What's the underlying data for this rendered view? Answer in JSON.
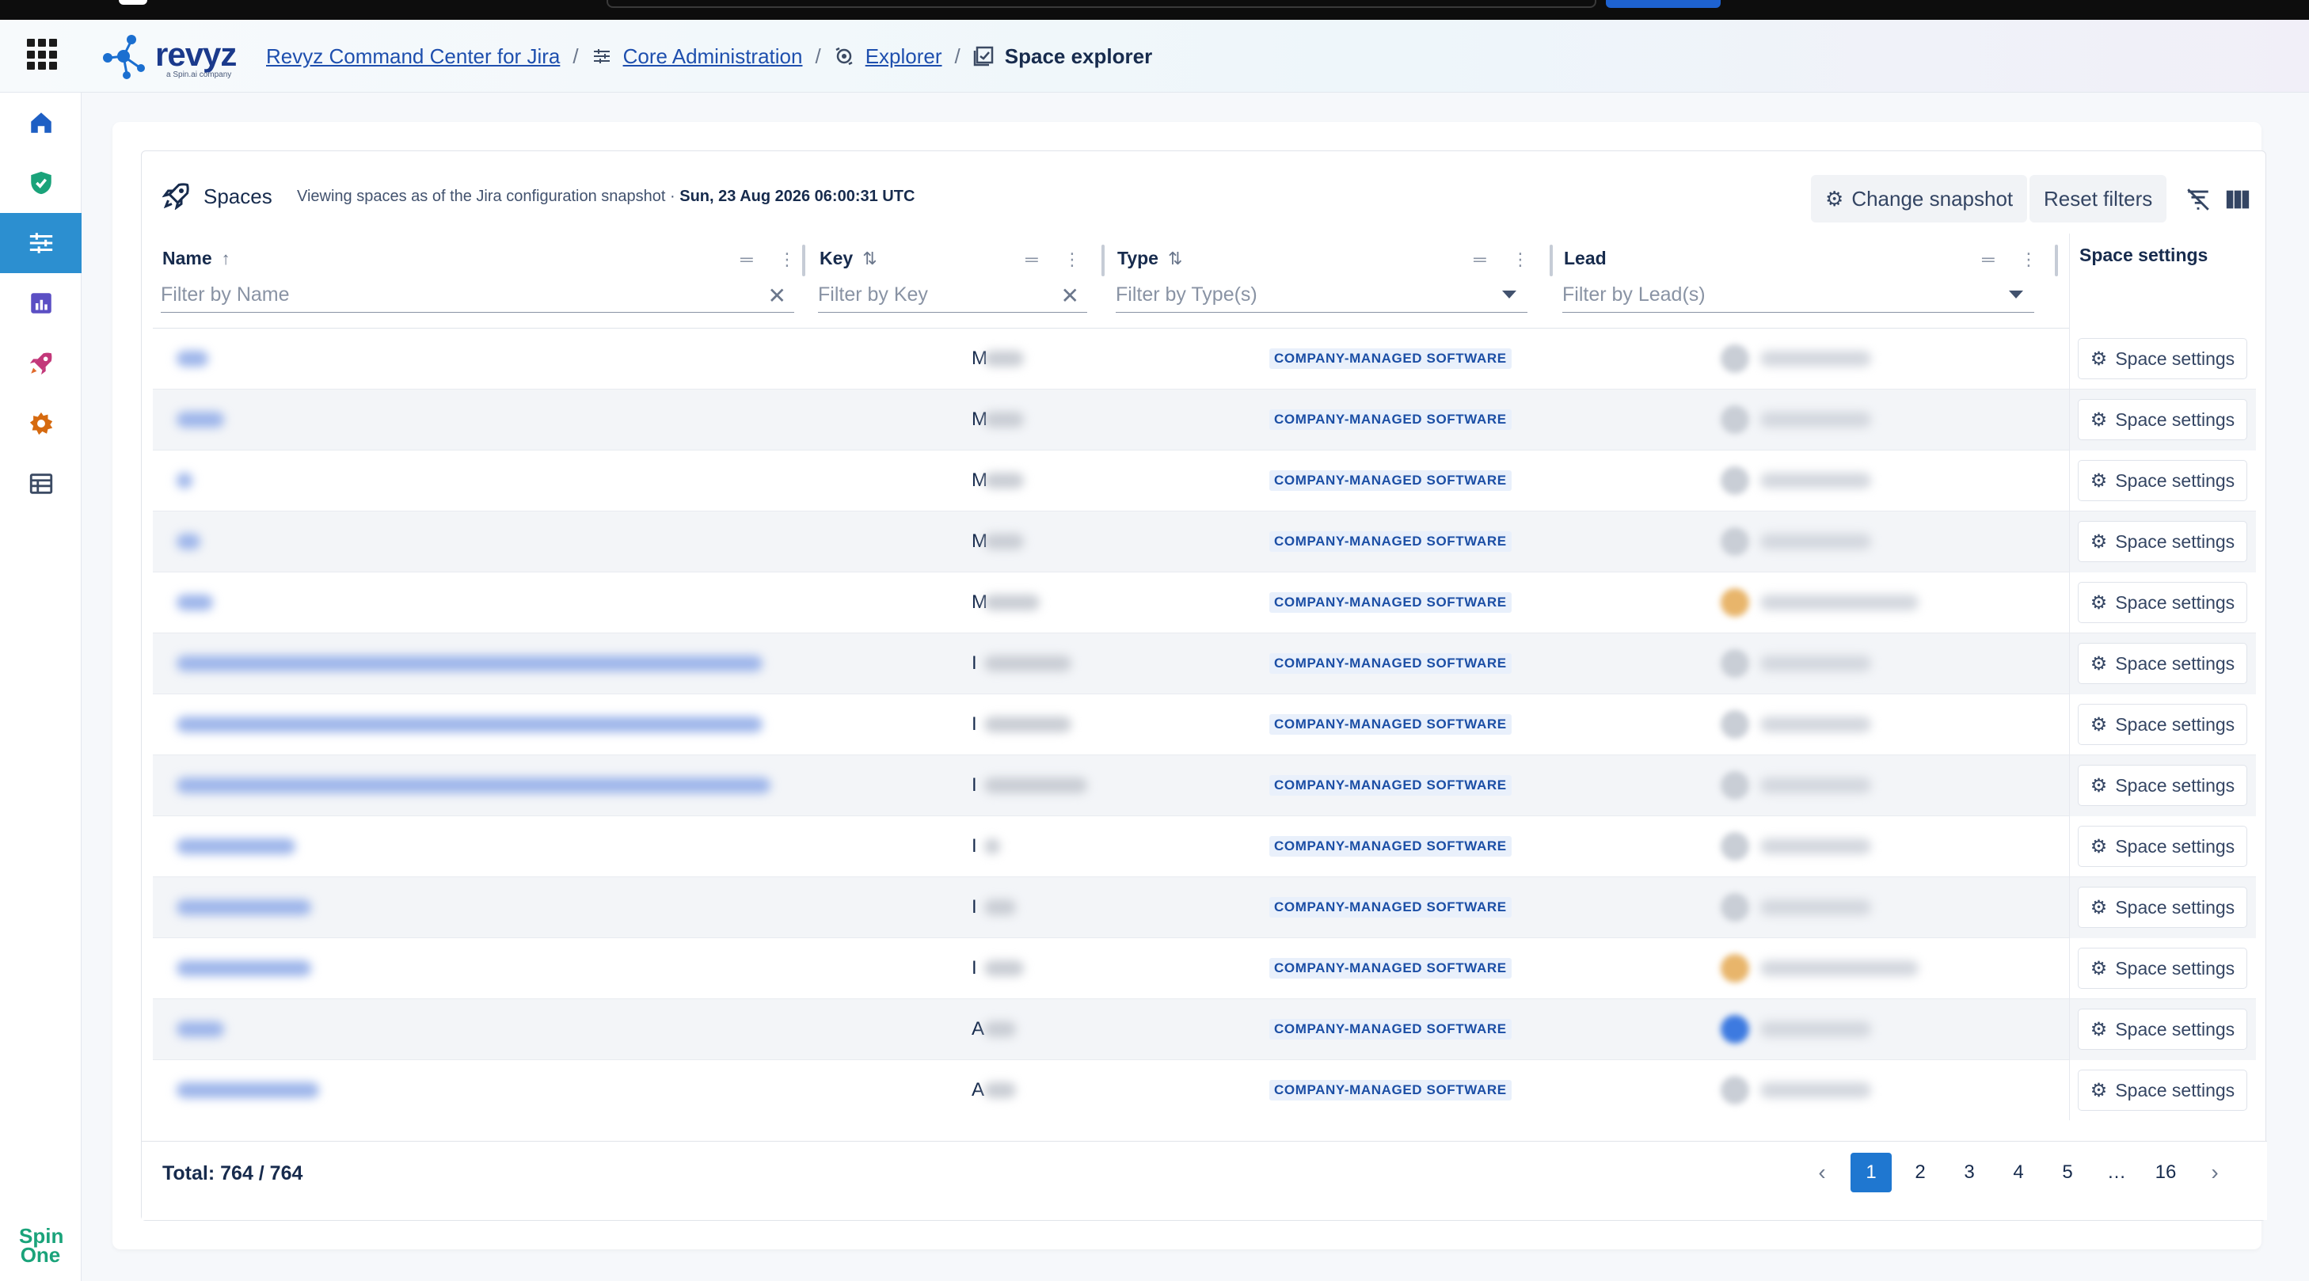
{
  "breadcrumb": {
    "items": [
      {
        "label": "Revyz Command Center for Jira"
      },
      {
        "label": "Core Administration"
      },
      {
        "label": "Explorer"
      }
    ],
    "current": "Space explorer",
    "separator": "/"
  },
  "logo": {
    "word": "revyz",
    "sub": "a Spin.ai company"
  },
  "sidebar_footer": {
    "line1": "Spin",
    "line2": "One"
  },
  "toolbar": {
    "title": "Spaces",
    "snapshot_prefix": "Viewing spaces as of the Jira configuration snapshot ·",
    "snapshot_date": "Sun, 23 Aug 2026 06:00:31 UTC",
    "change_snapshot_label": "Change snapshot",
    "reset_filters_label": "Reset filters"
  },
  "columns": {
    "name": {
      "label": "Name",
      "filter_placeholder": "Filter by Name",
      "sort": "↑"
    },
    "key": {
      "label": "Key",
      "filter_placeholder": "Filter by Key",
      "sort": "⇅"
    },
    "type": {
      "label": "Type",
      "filter_placeholder": "Filter by Type(s)",
      "sort": "⇅"
    },
    "lead": {
      "label": "Lead",
      "filter_placeholder": "Filter by Lead(s)"
    },
    "settings": {
      "label": "Space settings"
    }
  },
  "rows": [
    {
      "key_initial": "M",
      "type": "COMPANY-MANAGED SOFTWARE",
      "settings_label": "Space settings"
    },
    {
      "key_initial": "M",
      "type": "COMPANY-MANAGED SOFTWARE",
      "settings_label": "Space settings"
    },
    {
      "key_initial": "M",
      "type": "COMPANY-MANAGED SOFTWARE",
      "settings_label": "Space settings"
    },
    {
      "key_initial": "M",
      "type": "COMPANY-MANAGED SOFTWARE",
      "settings_label": "Space settings"
    },
    {
      "key_initial": "M",
      "type": "COMPANY-MANAGED SOFTWARE",
      "settings_label": "Space settings"
    },
    {
      "key_initial": "I",
      "type": "COMPANY-MANAGED SOFTWARE",
      "settings_label": "Space settings"
    },
    {
      "key_initial": "I",
      "type": "COMPANY-MANAGED SOFTWARE",
      "settings_label": "Space settings"
    },
    {
      "key_initial": "I",
      "type": "COMPANY-MANAGED SOFTWARE",
      "settings_label": "Space settings"
    },
    {
      "key_initial": "I",
      "type": "COMPANY-MANAGED SOFTWARE",
      "settings_label": "Space settings"
    },
    {
      "key_initial": "I",
      "type": "COMPANY-MANAGED SOFTWARE",
      "settings_label": "Space settings"
    },
    {
      "key_initial": "I",
      "type": "COMPANY-MANAGED SOFTWARE",
      "settings_label": "Space settings"
    },
    {
      "key_initial": "A",
      "type": "COMPANY-MANAGED SOFTWARE",
      "settings_label": "Space settings"
    },
    {
      "key_initial": "A",
      "type": "COMPANY-MANAGED SOFTWARE",
      "settings_label": "Space settings"
    }
  ],
  "footer": {
    "total": "Total: 764 / 764",
    "pages": [
      "1",
      "2",
      "3",
      "4",
      "5",
      "…",
      "16"
    ],
    "active_page": "1"
  },
  "colors": {
    "accent": "#1f77d0",
    "sidebar_active": "#2c8fd0",
    "badge_text": "#1b4ea5"
  },
  "icons": {
    "apps": "grid-icon",
    "sidebar": [
      "home-icon",
      "shield-icon",
      "sliders-icon",
      "chart-icon",
      "rocket-icon",
      "gear-icon",
      "table-icon"
    ]
  }
}
